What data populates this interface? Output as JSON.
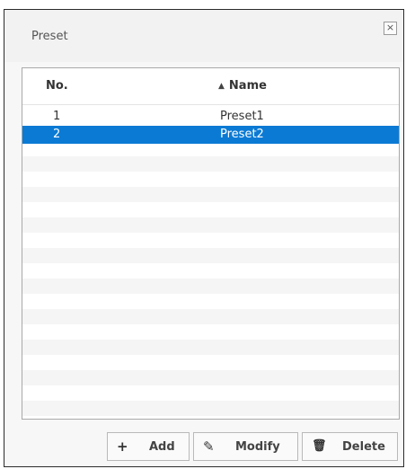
{
  "dialog": {
    "title": "Preset",
    "close_icon": "×"
  },
  "table": {
    "columns": {
      "no": "No.",
      "name": "Name",
      "sort_icon": "▲"
    },
    "rows": [
      {
        "no": "1",
        "name": "Preset1",
        "selected": false
      },
      {
        "no": "2",
        "name": "Preset2",
        "selected": true
      }
    ]
  },
  "buttons": {
    "add": {
      "label": "Add",
      "icon": "+"
    },
    "modify": {
      "label": "Modify",
      "icon": "✎"
    },
    "delete": {
      "label": "Delete",
      "icon": "🗑"
    }
  },
  "colors": {
    "selected_row": "#0b7ad4",
    "border": "#2b2b2b"
  }
}
